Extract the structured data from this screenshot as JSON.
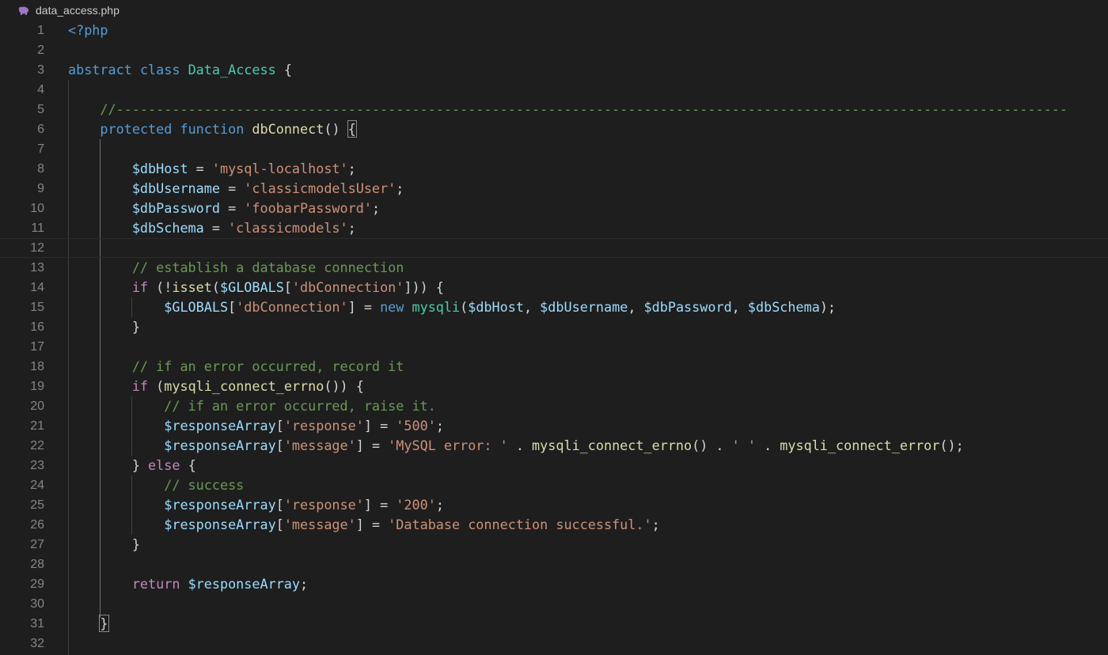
{
  "tab": {
    "filename": "data_access.php",
    "icon": "php-elephant-icon"
  },
  "lines": [
    {
      "n": "1",
      "tokens": [
        [
          "k-blue",
          "<?php"
        ]
      ]
    },
    {
      "n": "2",
      "tokens": []
    },
    {
      "n": "3",
      "tokens": [
        [
          "k-blue",
          "abstract"
        ],
        [
          "pun",
          " "
        ],
        [
          "k-blue",
          "class"
        ],
        [
          "pun",
          " "
        ],
        [
          "type",
          "Data_Access"
        ],
        [
          "pun",
          " {"
        ]
      ]
    },
    {
      "n": "4",
      "tokens": []
    },
    {
      "n": "5",
      "tokens": [
        [
          "pun",
          "    "
        ],
        [
          "cmt",
          "//-----------------------------------------------------------------------------------------------------------------------"
        ]
      ]
    },
    {
      "n": "6",
      "tokens": [
        [
          "pun",
          "    "
        ],
        [
          "k-blue",
          "protected"
        ],
        [
          "pun",
          " "
        ],
        [
          "k-blue",
          "function"
        ],
        [
          "pun",
          " "
        ],
        [
          "fn",
          "dbConnect"
        ],
        [
          "pun",
          "() "
        ],
        [
          "box",
          "{"
        ]
      ]
    },
    {
      "n": "7",
      "tokens": []
    },
    {
      "n": "8",
      "tokens": [
        [
          "pun",
          "        "
        ],
        [
          "var",
          "$dbHost"
        ],
        [
          "pun",
          " = "
        ],
        [
          "str",
          "'mysql-localhost'"
        ],
        [
          "pun",
          ";"
        ]
      ]
    },
    {
      "n": "9",
      "tokens": [
        [
          "pun",
          "        "
        ],
        [
          "var",
          "$dbUsername"
        ],
        [
          "pun",
          " = "
        ],
        [
          "str",
          "'classicmodelsUser'"
        ],
        [
          "pun",
          ";"
        ]
      ]
    },
    {
      "n": "10",
      "tokens": [
        [
          "pun",
          "        "
        ],
        [
          "var",
          "$dbPassword"
        ],
        [
          "pun",
          " = "
        ],
        [
          "str",
          "'foobarPassword'"
        ],
        [
          "pun",
          ";"
        ]
      ]
    },
    {
      "n": "11",
      "tokens": [
        [
          "pun",
          "        "
        ],
        [
          "var",
          "$dbSchema"
        ],
        [
          "pun",
          " = "
        ],
        [
          "str",
          "'classicmodels'"
        ],
        [
          "pun",
          ";"
        ]
      ]
    },
    {
      "n": "12",
      "tokens": [],
      "current": true
    },
    {
      "n": "13",
      "tokens": [
        [
          "pun",
          "        "
        ],
        [
          "cmt",
          "// establish a database connection"
        ]
      ]
    },
    {
      "n": "14",
      "tokens": [
        [
          "pun",
          "        "
        ],
        [
          "k-purple",
          "if"
        ],
        [
          "pun",
          " (!"
        ],
        [
          "fn",
          "isset"
        ],
        [
          "pun",
          "("
        ],
        [
          "var",
          "$GLOBALS"
        ],
        [
          "pun",
          "["
        ],
        [
          "str",
          "'dbConnection'"
        ],
        [
          "pun",
          "])) {"
        ]
      ]
    },
    {
      "n": "15",
      "tokens": [
        [
          "pun",
          "            "
        ],
        [
          "var",
          "$GLOBALS"
        ],
        [
          "pun",
          "["
        ],
        [
          "str",
          "'dbConnection'"
        ],
        [
          "pun",
          "] = "
        ],
        [
          "k-blue",
          "new"
        ],
        [
          "pun",
          " "
        ],
        [
          "type",
          "mysqli"
        ],
        [
          "pun",
          "("
        ],
        [
          "var",
          "$dbHost"
        ],
        [
          "pun",
          ", "
        ],
        [
          "var",
          "$dbUsername"
        ],
        [
          "pun",
          ", "
        ],
        [
          "var",
          "$dbPassword"
        ],
        [
          "pun",
          ", "
        ],
        [
          "var",
          "$dbSchema"
        ],
        [
          "pun",
          ");"
        ]
      ]
    },
    {
      "n": "16",
      "tokens": [
        [
          "pun",
          "        }"
        ]
      ]
    },
    {
      "n": "17",
      "tokens": []
    },
    {
      "n": "18",
      "tokens": [
        [
          "pun",
          "        "
        ],
        [
          "cmt",
          "// if an error occurred, record it"
        ]
      ]
    },
    {
      "n": "19",
      "tokens": [
        [
          "pun",
          "        "
        ],
        [
          "k-purple",
          "if"
        ],
        [
          "pun",
          " ("
        ],
        [
          "fn",
          "mysqli_connect_errno"
        ],
        [
          "pun",
          "()) {"
        ]
      ]
    },
    {
      "n": "20",
      "tokens": [
        [
          "pun",
          "            "
        ],
        [
          "cmt",
          "// if an error occurred, raise it."
        ]
      ]
    },
    {
      "n": "21",
      "tokens": [
        [
          "pun",
          "            "
        ],
        [
          "var",
          "$responseArray"
        ],
        [
          "pun",
          "["
        ],
        [
          "str",
          "'response'"
        ],
        [
          "pun",
          "] = "
        ],
        [
          "str",
          "'500'"
        ],
        [
          "pun",
          ";"
        ]
      ]
    },
    {
      "n": "22",
      "tokens": [
        [
          "pun",
          "            "
        ],
        [
          "var",
          "$responseArray"
        ],
        [
          "pun",
          "["
        ],
        [
          "str",
          "'message'"
        ],
        [
          "pun",
          "] = "
        ],
        [
          "str",
          "'MySQL error: '"
        ],
        [
          "pun",
          " . "
        ],
        [
          "fn",
          "mysqli_connect_errno"
        ],
        [
          "pun",
          "() . "
        ],
        [
          "str",
          "' '"
        ],
        [
          "pun",
          " . "
        ],
        [
          "fn",
          "mysqli_connect_error"
        ],
        [
          "pun",
          "();"
        ]
      ]
    },
    {
      "n": "23",
      "tokens": [
        [
          "pun",
          "        } "
        ],
        [
          "k-purple",
          "else"
        ],
        [
          "pun",
          " {"
        ]
      ]
    },
    {
      "n": "24",
      "tokens": [
        [
          "pun",
          "            "
        ],
        [
          "cmt",
          "// success"
        ]
      ]
    },
    {
      "n": "25",
      "tokens": [
        [
          "pun",
          "            "
        ],
        [
          "var",
          "$responseArray"
        ],
        [
          "pun",
          "["
        ],
        [
          "str",
          "'response'"
        ],
        [
          "pun",
          "] = "
        ],
        [
          "str",
          "'200'"
        ],
        [
          "pun",
          ";"
        ]
      ]
    },
    {
      "n": "26",
      "tokens": [
        [
          "pun",
          "            "
        ],
        [
          "var",
          "$responseArray"
        ],
        [
          "pun",
          "["
        ],
        [
          "str",
          "'message'"
        ],
        [
          "pun",
          "] = "
        ],
        [
          "str",
          "'Database connection successful.'"
        ],
        [
          "pun",
          ";"
        ]
      ]
    },
    {
      "n": "27",
      "tokens": [
        [
          "pun",
          "        }"
        ]
      ]
    },
    {
      "n": "28",
      "tokens": []
    },
    {
      "n": "29",
      "tokens": [
        [
          "pun",
          "        "
        ],
        [
          "k-purple",
          "return"
        ],
        [
          "pun",
          " "
        ],
        [
          "var",
          "$responseArray"
        ],
        [
          "pun",
          ";"
        ]
      ]
    },
    {
      "n": "30",
      "tokens": []
    },
    {
      "n": "31",
      "tokens": [
        [
          "pun",
          "    "
        ],
        [
          "box",
          "}"
        ]
      ]
    },
    {
      "n": "32",
      "tokens": []
    }
  ],
  "colors": {
    "background": "#1e1e1e",
    "keyword": "#569cd6",
    "control": "#c586c0",
    "type": "#4ec9b0",
    "function": "#dcdcaa",
    "variable": "#9cdcfe",
    "string": "#ce9178",
    "comment": "#6a9955",
    "line_number": "#858585"
  }
}
